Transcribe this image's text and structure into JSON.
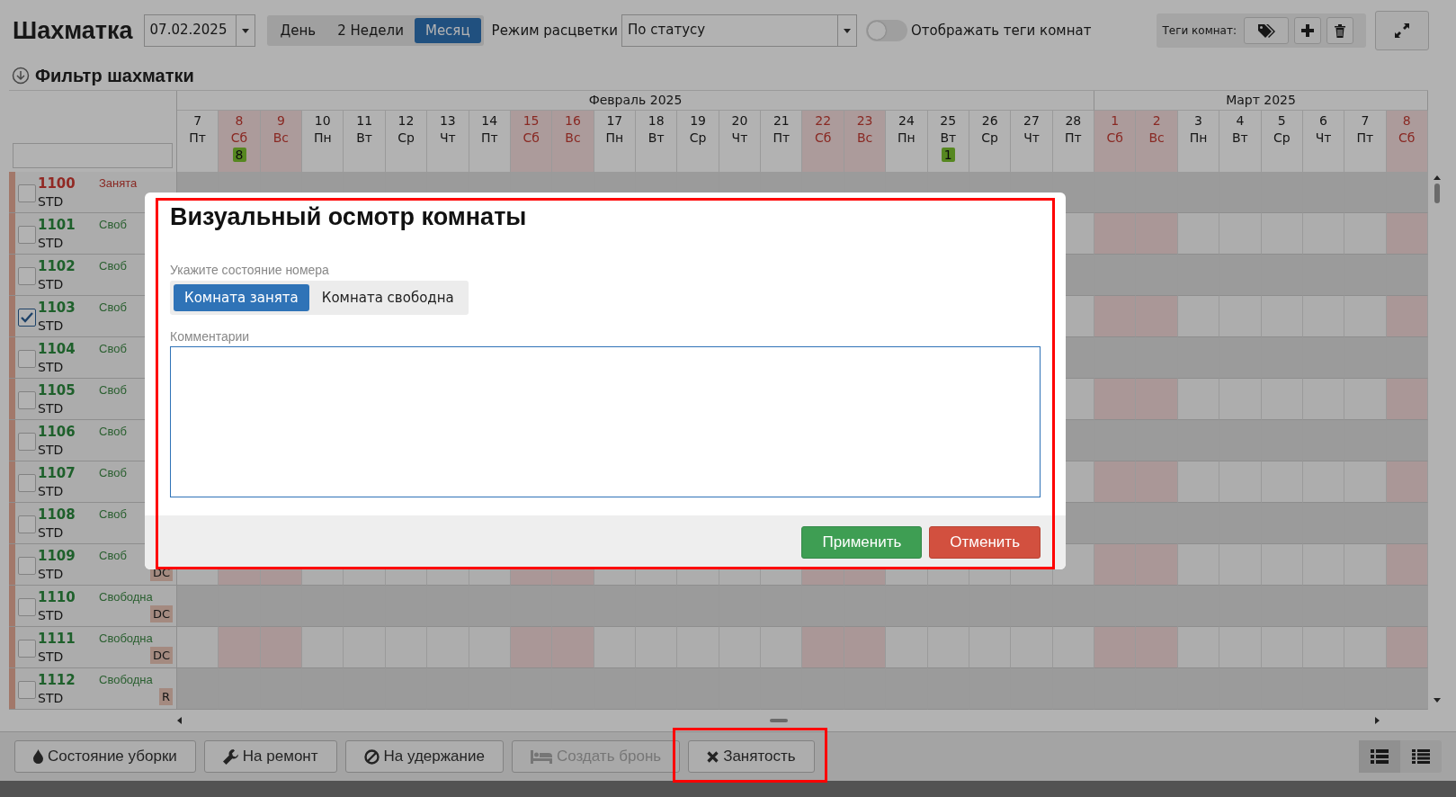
{
  "title": "Шахматка",
  "date_field": {
    "value": "07.02.2025"
  },
  "view_tabs": [
    {
      "label": "День",
      "selected": false
    },
    {
      "label": "2 Недели",
      "selected": false
    },
    {
      "label": "Месяц",
      "selected": true
    }
  ],
  "color_mode": {
    "label": "Режим расцветки",
    "value": "По статусу"
  },
  "tags_toggle": {
    "label": "Отображать теги комнат",
    "on": false
  },
  "room_tags": {
    "label": "Теги комнат:"
  },
  "filter": {
    "label": "Фильтр шахматки"
  },
  "calendar": {
    "months": [
      {
        "name": "Февраль 2025",
        "days": [
          {
            "day": "7",
            "weekday": "Пт",
            "weekend": false
          },
          {
            "day": "8",
            "weekday": "Сб",
            "weekend": true,
            "badge": "8"
          },
          {
            "day": "9",
            "weekday": "Вс",
            "weekend": true
          },
          {
            "day": "10",
            "weekday": "Пн",
            "weekend": false
          },
          {
            "day": "11",
            "weekday": "Вт",
            "weekend": false
          },
          {
            "day": "12",
            "weekday": "Ср",
            "weekend": false
          },
          {
            "day": "13",
            "weekday": "Чт",
            "weekend": false
          },
          {
            "day": "14",
            "weekday": "Пт",
            "weekend": false
          },
          {
            "day": "15",
            "weekday": "Сб",
            "weekend": true
          },
          {
            "day": "16",
            "weekday": "Вс",
            "weekend": true
          },
          {
            "day": "17",
            "weekday": "Пн",
            "weekend": false
          },
          {
            "day": "18",
            "weekday": "Вт",
            "weekend": false
          },
          {
            "day": "19",
            "weekday": "Ср",
            "weekend": false
          },
          {
            "day": "20",
            "weekday": "Чт",
            "weekend": false
          },
          {
            "day": "21",
            "weekday": "Пт",
            "weekend": false
          },
          {
            "day": "22",
            "weekday": "Сб",
            "weekend": true
          },
          {
            "day": "23",
            "weekday": "Вс",
            "weekend": true
          },
          {
            "day": "24",
            "weekday": "Пн",
            "weekend": false
          },
          {
            "day": "25",
            "weekday": "Вт",
            "weekend": false,
            "badge": "1"
          },
          {
            "day": "26",
            "weekday": "Ср",
            "weekend": false
          },
          {
            "day": "27",
            "weekday": "Чт",
            "weekend": false
          },
          {
            "day": "28",
            "weekday": "Пт",
            "weekend": false
          }
        ]
      },
      {
        "name": "Март 2025",
        "days": [
          {
            "day": "1",
            "weekday": "Сб",
            "weekend": true
          },
          {
            "day": "2",
            "weekday": "Вс",
            "weekend": true
          },
          {
            "day": "3",
            "weekday": "Пн",
            "weekend": false
          },
          {
            "day": "4",
            "weekday": "Вт",
            "weekend": false
          },
          {
            "day": "5",
            "weekday": "Ср",
            "weekend": false
          },
          {
            "day": "6",
            "weekday": "Чт",
            "weekend": false
          },
          {
            "day": "7",
            "weekday": "Пт",
            "weekend": false
          },
          {
            "day": "8",
            "weekday": "Сб",
            "weekend": true
          }
        ]
      }
    ],
    "rooms": [
      {
        "number": "1100",
        "type": "STD",
        "status": "Занята",
        "kind": "occupied",
        "checked": false
      },
      {
        "number": "1101",
        "type": "STD",
        "status": "Своб",
        "kind": "free",
        "checked": false
      },
      {
        "number": "1102",
        "type": "STD",
        "status": "Своб",
        "kind": "free",
        "checked": false
      },
      {
        "number": "1103",
        "type": "STD",
        "status": "Своб",
        "kind": "free",
        "checked": true
      },
      {
        "number": "1104",
        "type": "STD",
        "status": "Своб",
        "kind": "free",
        "checked": false
      },
      {
        "number": "1105",
        "type": "STD",
        "status": "Своб",
        "kind": "free",
        "checked": false
      },
      {
        "number": "1106",
        "type": "STD",
        "status": "Своб",
        "kind": "free",
        "checked": false
      },
      {
        "number": "1107",
        "type": "STD",
        "status": "Своб",
        "kind": "free",
        "checked": false
      },
      {
        "number": "1108",
        "type": "STD",
        "status": "Своб",
        "kind": "free",
        "checked": false
      },
      {
        "number": "1109",
        "type": "STD",
        "status": "Своб",
        "kind": "free",
        "checked": false,
        "tag": "DC"
      },
      {
        "number": "1110",
        "type": "STD",
        "status": "Свободна",
        "kind": "free",
        "checked": false,
        "tag": "DC"
      },
      {
        "number": "1111",
        "type": "STD",
        "status": "Свободна",
        "kind": "free",
        "checked": false,
        "tag": "DC"
      },
      {
        "number": "1112",
        "type": "STD",
        "status": "Свободна",
        "kind": "free",
        "checked": false,
        "tag": "R"
      }
    ]
  },
  "bottom_buttons": [
    {
      "label": "Состояние уборки",
      "kind": "drop",
      "disabled": false,
      "highlighted": false
    },
    {
      "label": "На ремонт",
      "kind": "wrench",
      "disabled": false,
      "highlighted": false
    },
    {
      "label": "На удержание",
      "kind": "ban",
      "disabled": false,
      "highlighted": false
    },
    {
      "label": "Создать бронь",
      "kind": "bed",
      "disabled": true,
      "highlighted": false
    },
    {
      "label": "Занятость",
      "kind": "cross",
      "disabled": false,
      "highlighted": true
    }
  ],
  "view_buttons": [
    {
      "kind": "list",
      "selected": true
    },
    {
      "kind": "table",
      "selected": false
    }
  ],
  "modal": {
    "title": "Визуальный осмотр комнаты",
    "highlighted": true,
    "state_label": "Укажите состояние номера",
    "state_options": [
      {
        "label": "Комната занята",
        "selected": true
      },
      {
        "label": "Комната свободна",
        "selected": false
      }
    ],
    "comment_label": "Комментарии",
    "buttons": [
      {
        "label": "Применить",
        "kind": "apply"
      },
      {
        "label": "Отменить",
        "kind": "cancel"
      }
    ]
  }
}
